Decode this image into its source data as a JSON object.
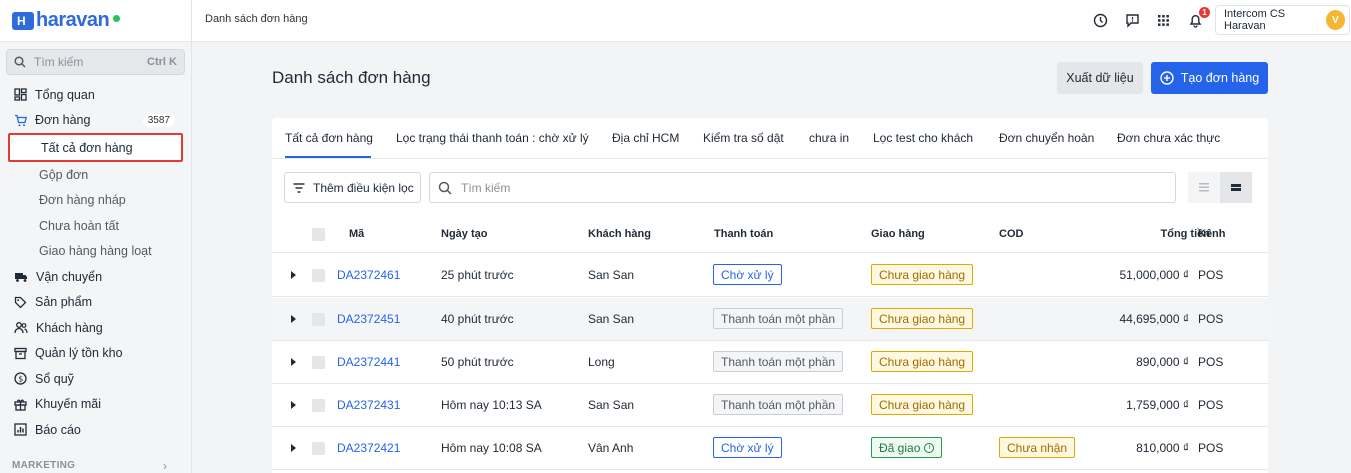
{
  "app": {
    "logo_text": "haravan",
    "brand_color": "#2f6bd9"
  },
  "sidebar": {
    "search_placeholder": "Tìm kiếm",
    "search_shortcut": "Ctrl K",
    "items": [
      {
        "label": "Tổng quan",
        "icon": "dashboard-icon"
      },
      {
        "label": "Đơn hàng",
        "icon": "cart-icon",
        "badge": "3587"
      },
      {
        "label": "Vận chuyển",
        "icon": "truck-icon"
      },
      {
        "label": "Sản phẩm",
        "icon": "tag-icon"
      },
      {
        "label": "Khách hàng",
        "icon": "users-icon"
      },
      {
        "label": "Quản lý tồn kho",
        "icon": "inventory-icon"
      },
      {
        "label": "Sổ quỹ",
        "icon": "dollar-icon"
      },
      {
        "label": "Khuyến mãi",
        "icon": "gift-icon"
      },
      {
        "label": "Báo cáo",
        "icon": "report-icon"
      }
    ],
    "order_subitems": [
      "Tất cả đơn hàng",
      "Gộp đơn",
      "Đơn hàng nháp",
      "Chưa hoàn tất",
      "Giao hàng hàng loạt"
    ],
    "section_marketing": "MARKETING"
  },
  "topbar": {
    "breadcrumb": "Danh sách đơn hàng",
    "notification_count": "1",
    "user_name": "Intercom CS Haravan",
    "user_initial": "V"
  },
  "page": {
    "title": "Danh sách đơn hàng",
    "export_label": "Xuất dữ liệu",
    "create_label": "Tạo đơn hàng"
  },
  "tabs": [
    "Tất cả đơn hàng",
    "Lọc trạng thái thanh toán : chờ xử lý",
    "Địa chỉ HCM",
    "Kiểm tra số dật",
    "chưa in",
    "Lọc test cho khách",
    "Đơn chuyển hoàn",
    "Đơn chưa xác thực"
  ],
  "filters": {
    "add_filter_label": "Thêm điều kiện lọc",
    "search_placeholder": "Tìm kiếm"
  },
  "table": {
    "columns": [
      "Mã",
      "Ngày tạo",
      "Khách hàng",
      "Thanh toán",
      "Giao hàng",
      "COD",
      "Tổng tiền",
      "Kênh"
    ],
    "rows": [
      {
        "code": "DA2372461",
        "created": "25 phút trước",
        "customer": "San San",
        "payment": "Chờ xử lý",
        "shipping": "Chưa giao hàng",
        "cod": "",
        "total": "51,000,000 ₫",
        "channel": "POS"
      },
      {
        "code": "DA2372451",
        "created": "40 phút trước",
        "customer": "San San",
        "payment": "Thanh toán một phần",
        "shipping": "Chưa giao hàng",
        "cod": "",
        "total": "44,695,000 ₫",
        "channel": "POS"
      },
      {
        "code": "DA2372441",
        "created": "50 phút trước",
        "customer": "Long",
        "payment": "Thanh toán một phần",
        "shipping": "Chưa giao hàng",
        "cod": "",
        "total": "890,000 ₫",
        "channel": "POS"
      },
      {
        "code": "DA2372431",
        "created": "Hôm nay 10:13 SA",
        "customer": "San San",
        "payment": "Thanh toán một phần",
        "shipping": "Chưa giao hàng",
        "cod": "",
        "total": "1,759,000 ₫",
        "channel": "POS"
      },
      {
        "code": "DA2372421",
        "created": "Hôm nay 10:08 SA",
        "customer": "Vân Anh",
        "payment": "Chờ xử lý",
        "shipping": "Đã giao",
        "cod": "Chưa nhận",
        "total": "810,000 ₫",
        "channel": "POS"
      }
    ]
  }
}
